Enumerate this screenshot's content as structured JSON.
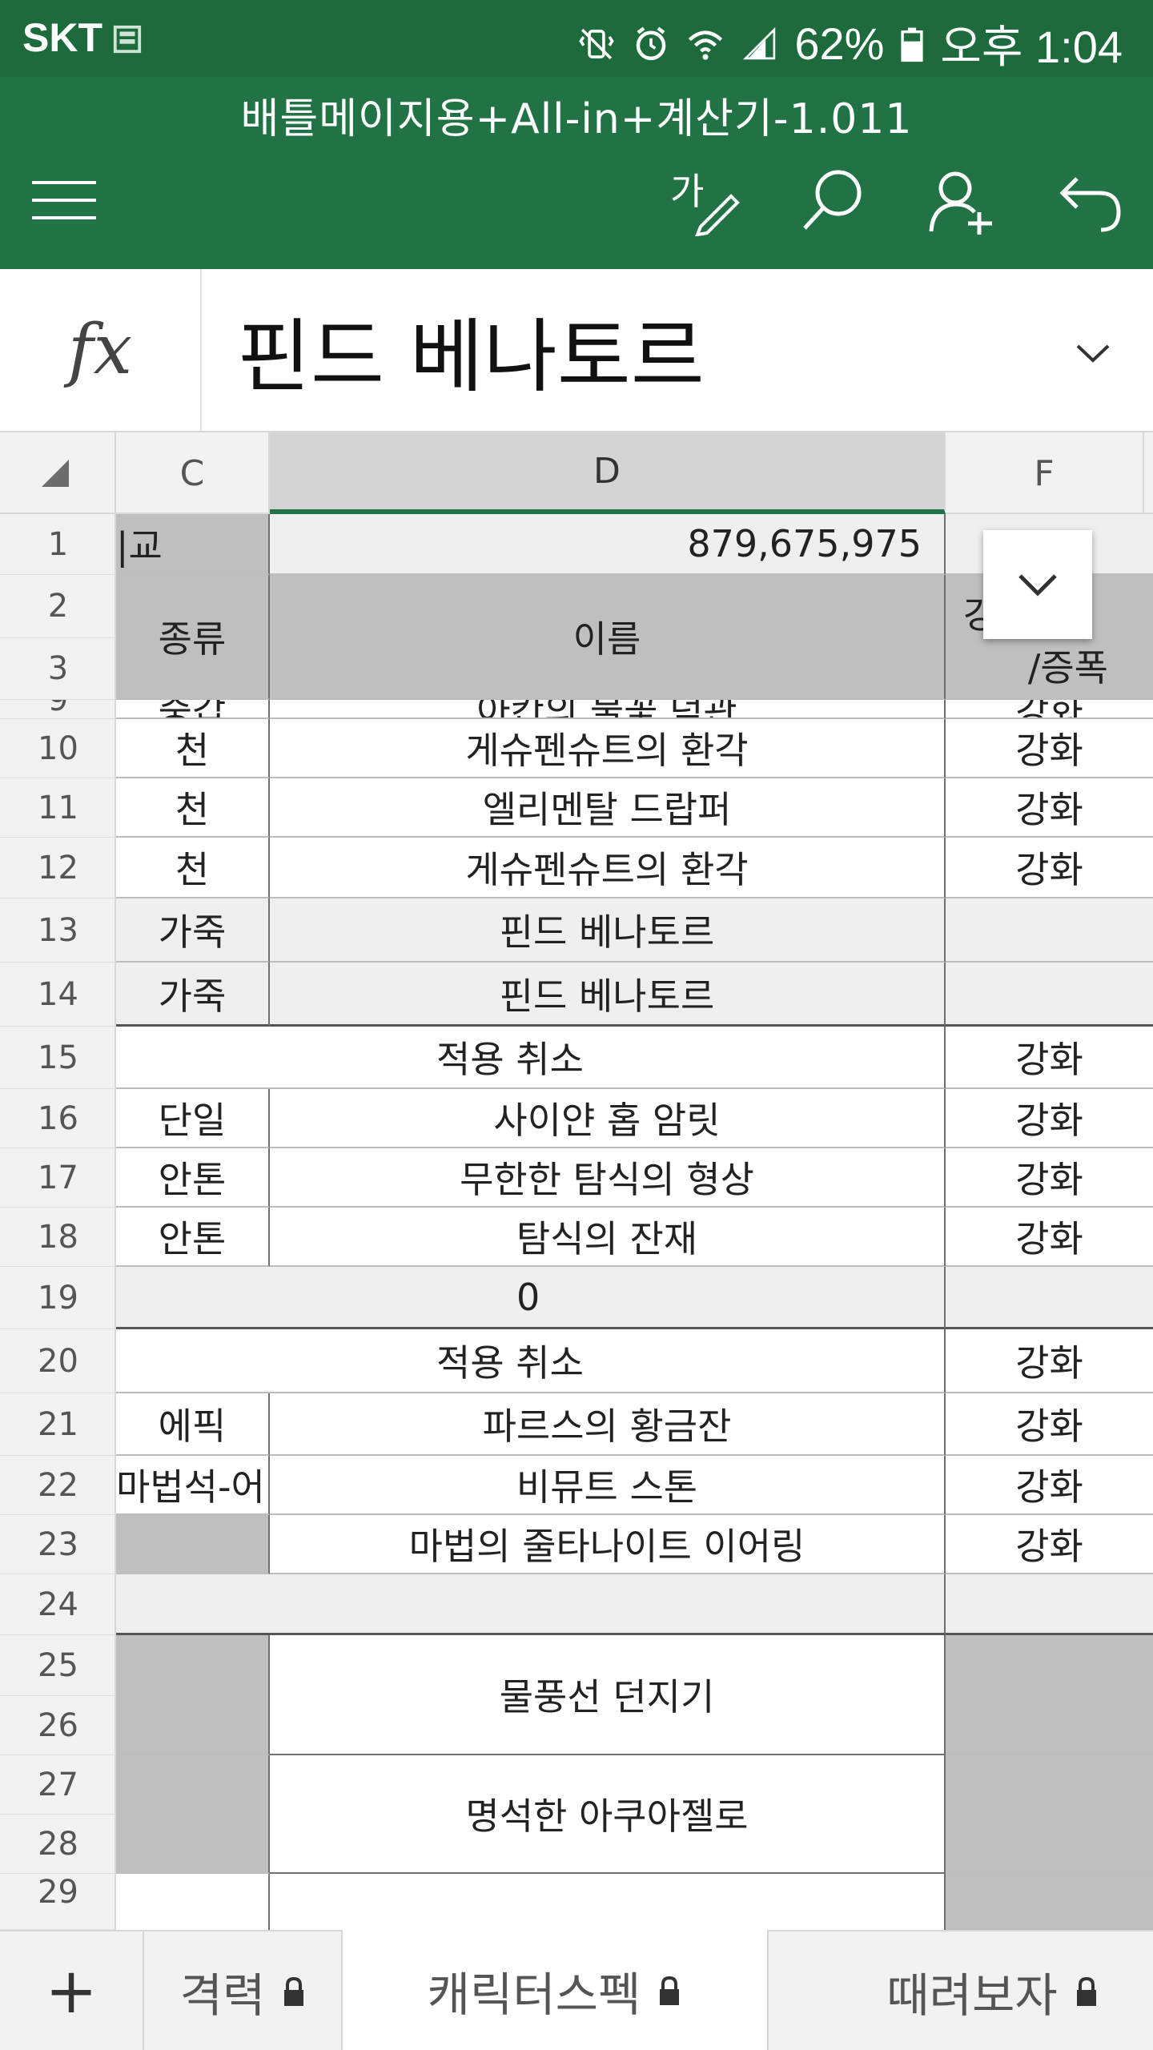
{
  "status_bar": {
    "carrier": "SKT",
    "battery": "62%",
    "time": "오후 1:04"
  },
  "document": {
    "title": "배틀메이지용+All-in+계산기-1.011"
  },
  "toolbar": {
    "menu_icon": "hamburger-menu-icon",
    "edit_icon": "pen-edit-icon",
    "search_icon": "search-icon",
    "share_icon": "add-person-icon",
    "undo_icon": "undo-icon"
  },
  "formula_bar": {
    "fx_label": "fx",
    "value": "핀드 베나토르"
  },
  "columns": [
    "C",
    "D",
    "F"
  ],
  "rows": [
    "1",
    "2",
    "3",
    "9",
    "10",
    "11",
    "12",
    "13",
    "14",
    "15",
    "16",
    "17",
    "18",
    "19",
    "20",
    "21",
    "22",
    "23",
    "24",
    "25",
    "26",
    "27",
    "28",
    "29"
  ],
  "cells": {
    "r1_c": "|교",
    "r1_d": "879,675,975",
    "header_c": "종류",
    "header_d": "이름",
    "header_f_top": "강",
    "header_f_bottom": "/증폭",
    "r9_c": "중갑",
    "r9_d": "아칸의 불꽃 덕관",
    "r9_f": "강화",
    "r10_c": "천",
    "r10_d": "게슈펜슈트의 환각",
    "r10_f": "강화",
    "r11_c": "천",
    "r11_d": "엘리멘탈 드랍퍼",
    "r11_f": "강화",
    "r12_c": "천",
    "r12_d": "게슈펜슈트의 환각",
    "r12_f": "강화",
    "r13_c": "가죽",
    "r13_d": "핀드 베나토르",
    "r13_f": "",
    "r14_c": "가죽",
    "r14_d": "핀드 베나토르",
    "r14_f": "",
    "r15_cd": "적용 취소",
    "r15_f": "강화",
    "r16_c": "단일",
    "r16_d": "사이얀 홉 암릿",
    "r16_f": "강화",
    "r17_c": "안톤",
    "r17_d": "무한한 탐식의 형상",
    "r17_f": "강화",
    "r18_c": "안톤",
    "r18_d": "탐식의 잔재",
    "r18_f": "강화",
    "r19_cd": "0",
    "r19_f": "",
    "r20_cd": "적용 취소",
    "r20_f": "강화",
    "r21_c": "에픽",
    "r21_d": "파르스의 황금잔",
    "r21_f": "강화",
    "r22_c": "마법석-어",
    "r22_d": "비뮤트 스톤",
    "r22_f": "강화",
    "r23_c": "",
    "r23_d": "마법의 줄타나이트 이어링",
    "r23_f": "강화",
    "r25_d": "물풍선 던지기",
    "r27_d": "명석한 아쿠아젤로"
  },
  "tabs": [
    {
      "label": "격력",
      "locked": true
    },
    {
      "label": "캐릭터스펙",
      "locked": true,
      "active": true
    },
    {
      "label": "때려보자",
      "locked": true
    }
  ],
  "add_sheet_label": "+",
  "colors": {
    "status_bar": "#1d6b3d",
    "title_bar": "#217346",
    "header_gray": "#bfbfbf",
    "selection_green": "#217346"
  }
}
